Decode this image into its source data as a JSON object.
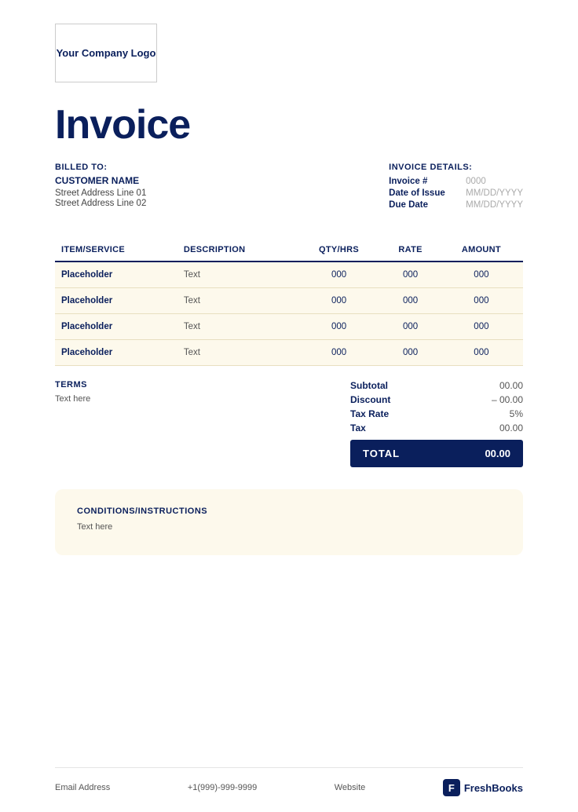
{
  "logo": {
    "text": "Your Company Logo"
  },
  "invoice": {
    "title": "Invoice"
  },
  "billed": {
    "label": "BILLED TO:",
    "customer_name": "CUSTOMER NAME",
    "address_line1": "Street Address Line 01",
    "address_line2": "Street Address Line 02"
  },
  "invoice_details": {
    "label": "INVOICE DETAILS:",
    "fields": [
      {
        "key": "Invoice #",
        "value": "0000"
      },
      {
        "key": "Date of Issue",
        "value": "MM/DD/YYYY"
      },
      {
        "key": "Due Date",
        "value": "MM/DD/YYYY"
      }
    ]
  },
  "table": {
    "headers": [
      "ITEM/SERVICE",
      "DESCRIPTION",
      "QTY/HRS",
      "RATE",
      "AMOUNT"
    ],
    "rows": [
      {
        "item": "Placeholder",
        "desc": "Text",
        "qty": "000",
        "rate": "000",
        "amount": "000"
      },
      {
        "item": "Placeholder",
        "desc": "Text",
        "qty": "000",
        "rate": "000",
        "amount": "000"
      },
      {
        "item": "Placeholder",
        "desc": "Text",
        "qty": "000",
        "rate": "000",
        "amount": "000"
      },
      {
        "item": "Placeholder",
        "desc": "Text",
        "qty": "000",
        "rate": "000",
        "amount": "000"
      }
    ]
  },
  "terms": {
    "label": "TERMS",
    "text": "Text here"
  },
  "totals": {
    "subtotal_label": "Subtotal",
    "subtotal_value": "00.00",
    "discount_label": "Discount",
    "discount_value": "– 00.00",
    "tax_rate_label": "Tax Rate",
    "tax_rate_value": "5%",
    "tax_label": "Tax",
    "tax_value": "00.00",
    "total_label": "TOTAL",
    "total_value": "00.00"
  },
  "conditions": {
    "label": "CONDITIONS/INSTRUCTIONS",
    "text": "Text here"
  },
  "footer": {
    "email": "Email Address",
    "phone": "+1(999)-999-9999",
    "website": "Website",
    "brand": "FreshBooks",
    "brand_icon": "F"
  }
}
